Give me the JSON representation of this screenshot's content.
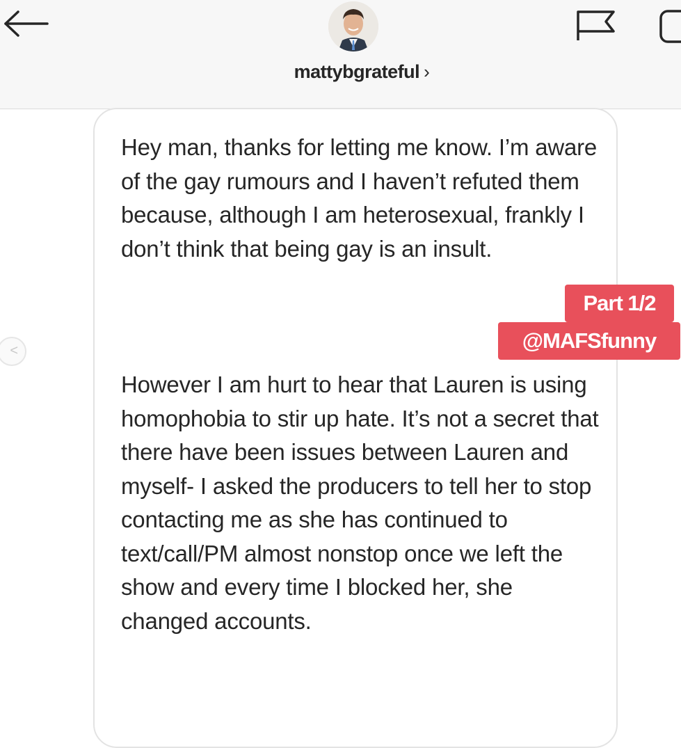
{
  "header": {
    "username": "mattybgrateful",
    "chevron": "›",
    "back_icon": "arrow-left-icon",
    "flag_icon": "flag-icon",
    "info_icon": "info-icon"
  },
  "message": {
    "paragraph_1": "Hey man, thanks for letting me know. I’m aware of the gay rumours and I haven’t refuted them because, although I am heterosexual, frankly I don’t think that being gay is an insult.",
    "paragraph_2": "However I am hurt to hear that Lauren is using homophobia to stir up hate. It’s not a secret that there have been issues between Lauren and myself- I asked the producers to tell her to stop contacting me as she has continued to text/call/PM almost nonstop once we left the show and every time I blocked her, she changed accounts."
  },
  "overlay": {
    "part_label": "Part 1/2",
    "handle": "@MAFSfunny",
    "accent_color": "#e8505b"
  },
  "side_arrow_glyph": "<"
}
